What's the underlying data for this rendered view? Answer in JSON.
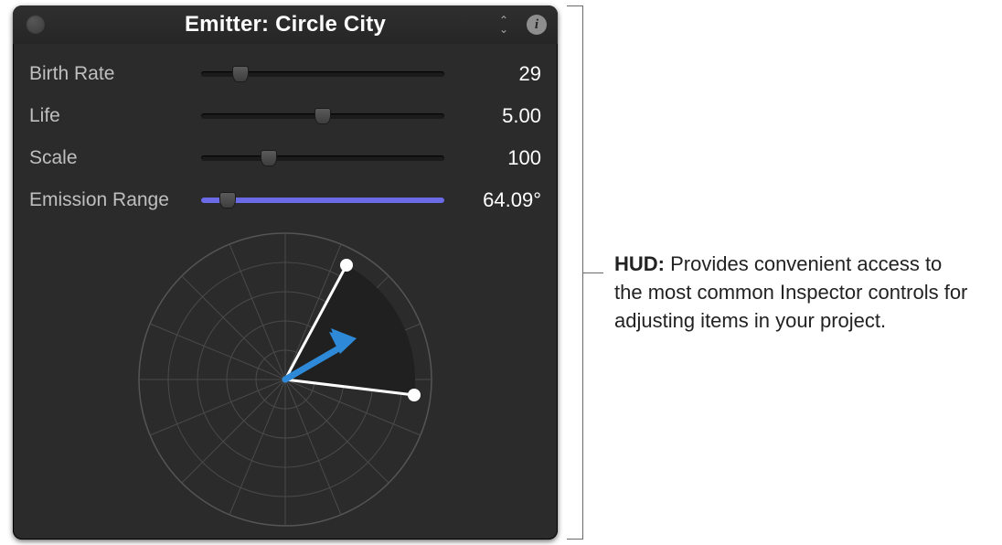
{
  "hud": {
    "title": "Emitter: Circle City",
    "params": [
      {
        "label": "Birth Rate",
        "value": "29",
        "thumb_pct": 16,
        "fill_pct": 0
      },
      {
        "label": "Life",
        "value": "5.00",
        "thumb_pct": 50,
        "fill_pct": 0
      },
      {
        "label": "Scale",
        "value": "100",
        "thumb_pct": 28,
        "fill_pct": 0
      },
      {
        "label": "Emission Range",
        "value": "64.09°",
        "thumb_pct": 11,
        "fill_pct": 100
      }
    ],
    "radial": {
      "angle_deg": 64.09,
      "direction_deg": 30
    }
  },
  "callout": {
    "label": "HUD:",
    "text": "Provides convenient access to the most common Inspector controls for adjusting items in your project."
  },
  "icons": {
    "info": "i",
    "up": "⌃",
    "down": "⌄"
  }
}
